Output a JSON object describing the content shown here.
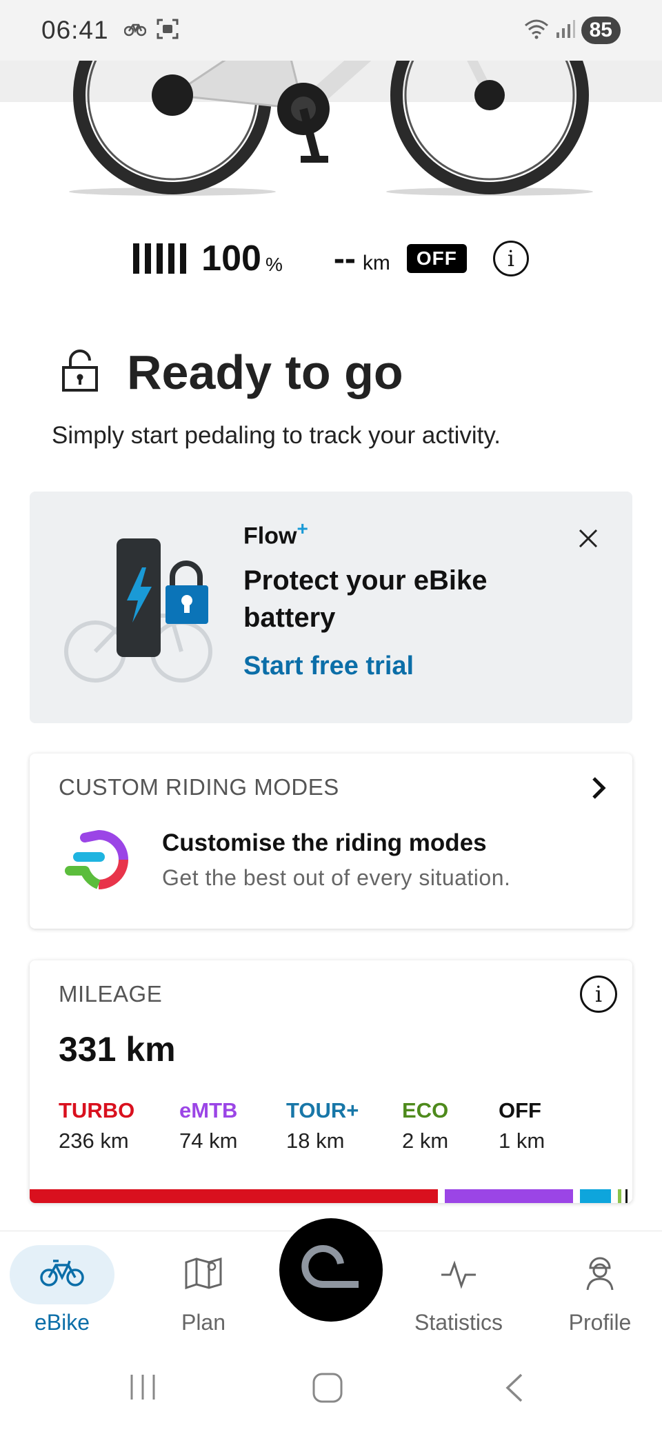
{
  "status_bar": {
    "time": "06:41",
    "battery_level": "85"
  },
  "bike_status": {
    "battery_percent": "100",
    "battery_unit": "%",
    "range_value": "--",
    "range_unit": "km",
    "assist_mode": "OFF"
  },
  "ready": {
    "title": "Ready to go",
    "subtitle": "Simply start pedaling to track your activity."
  },
  "promo": {
    "brand": "Flow",
    "brand_plus": "+",
    "title": "Protect your eBike battery",
    "cta": "Start free trial"
  },
  "riding_modes": {
    "section_title": "CUSTOM RIDING MODES",
    "title": "Customise the riding modes",
    "description": "Get the best out of every situation."
  },
  "mileage": {
    "section_title": "MILEAGE",
    "total": "331 km",
    "modes": [
      {
        "name": "TURBO",
        "value": "236 km",
        "km": 236,
        "color": "#d9101e"
      },
      {
        "name": "eMTB",
        "value": "74 km",
        "km": 74,
        "color": "#9b45e6"
      },
      {
        "name": "TOUR+",
        "value": "18 km",
        "km": 18,
        "color": "#1877a8"
      },
      {
        "name": "ECO",
        "value": "2 km",
        "km": 2,
        "color": "#4e8a1c"
      },
      {
        "name": "OFF",
        "value": "1 km",
        "km": 1,
        "color": "#111111"
      }
    ],
    "bar_colors": {
      "turbo": "#d9101e",
      "emtb": "#9b45e6",
      "tour": "#0ea5dc",
      "eco": "#8bc34a",
      "off": "#111111"
    }
  },
  "bottom_nav": {
    "ebike": "eBike",
    "plan": "Plan",
    "statistics": "Statistics",
    "profile": "Profile"
  },
  "colors": {
    "accent": "#0b6ea8",
    "promo_bg": "#eef0f2"
  },
  "icons": [
    "bike-icon",
    "screenshot-icon",
    "wifi-icon",
    "signal-icon",
    "lock-icon",
    "info-icon",
    "close-icon",
    "chevron-right-icon",
    "map-icon",
    "pulse-icon",
    "profile-icon",
    "ride-icon",
    "recents-icon",
    "home-icon",
    "back-icon"
  ]
}
